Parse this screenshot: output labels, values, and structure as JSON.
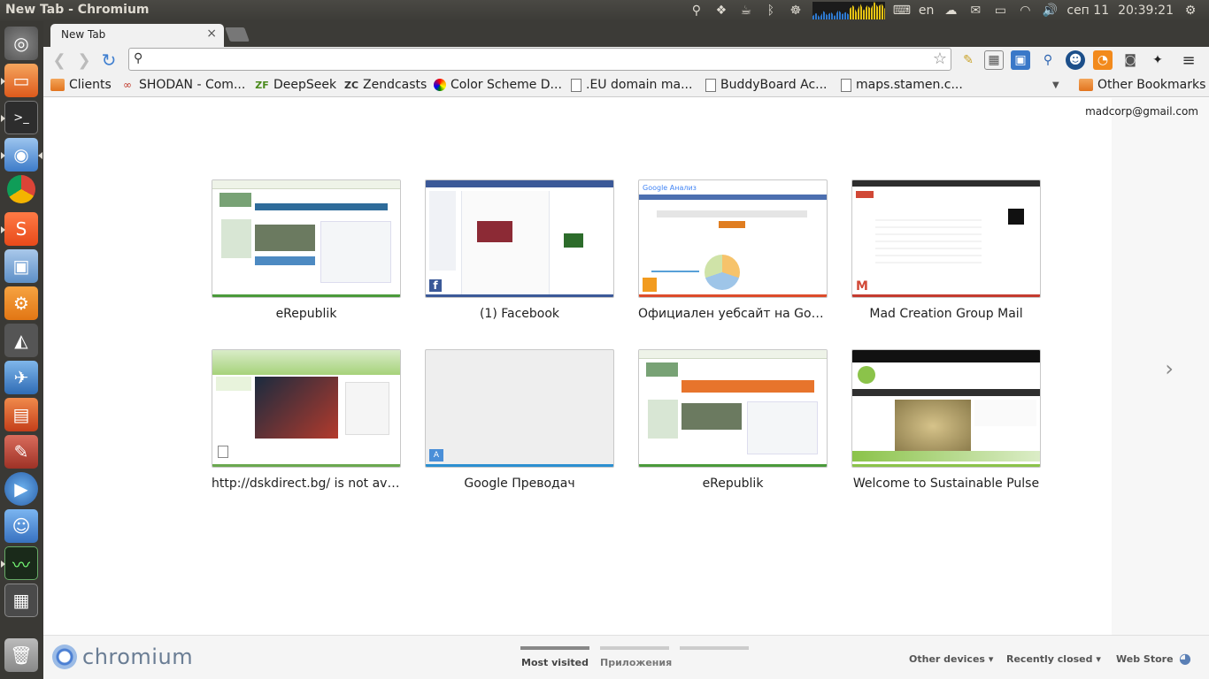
{
  "window": {
    "title": "New Tab - Chromium"
  },
  "panel": {
    "keyboard_layout": "en",
    "date": "сеп 11",
    "time": "20:39:21"
  },
  "tabs": [
    {
      "label": "New Tab",
      "close": "×"
    }
  ],
  "toolbar": {
    "omnibox_value": ""
  },
  "bookmarks": [
    {
      "label": "Clients",
      "icon": "folder-icon"
    },
    {
      "label": "SHODAN - Com...",
      "icon": "shodan-icon"
    },
    {
      "label": "DeepSeek",
      "icon": "deepseek-icon"
    },
    {
      "label": "Zendcasts",
      "icon": "zendcasts-icon"
    },
    {
      "label": "Color Scheme D...",
      "icon": "colorscheme-icon"
    },
    {
      "label": ".EU domain ma...",
      "icon": "page-icon"
    },
    {
      "label": "BuddyBoard Ac...",
      "icon": "page-icon"
    },
    {
      "label": "maps.stamen.c...",
      "icon": "page-icon"
    }
  ],
  "other_bookmarks": "Other Bookmarks",
  "account": "madcorp@gmail.com",
  "most_visited": [
    {
      "title": "eRepublik",
      "accent": "#4a9a3a"
    },
    {
      "title": "(1) Facebook",
      "accent": "#3b5998"
    },
    {
      "title": "Официален уебсайт на Googl...",
      "accent": "#dd4b2a"
    },
    {
      "title": "Mad Creation Group Mail",
      "accent": "#c43b2f"
    },
    {
      "title": "http://dskdirect.bg/ is not avai...",
      "accent": "#6aa84f"
    },
    {
      "title": "Google Преводач",
      "accent": "#2b8fd0"
    },
    {
      "title": "eRepublik",
      "accent": "#4a9a3a"
    },
    {
      "title": "Welcome to Sustainable Pulse",
      "accent": "#8bc34a"
    }
  ],
  "footer": {
    "brand": "chromium",
    "tabs": [
      "Most visited",
      "Приложения",
      ""
    ],
    "other_devices": "Other devices",
    "recently_closed": "Recently closed",
    "web_store": "Web Store"
  }
}
